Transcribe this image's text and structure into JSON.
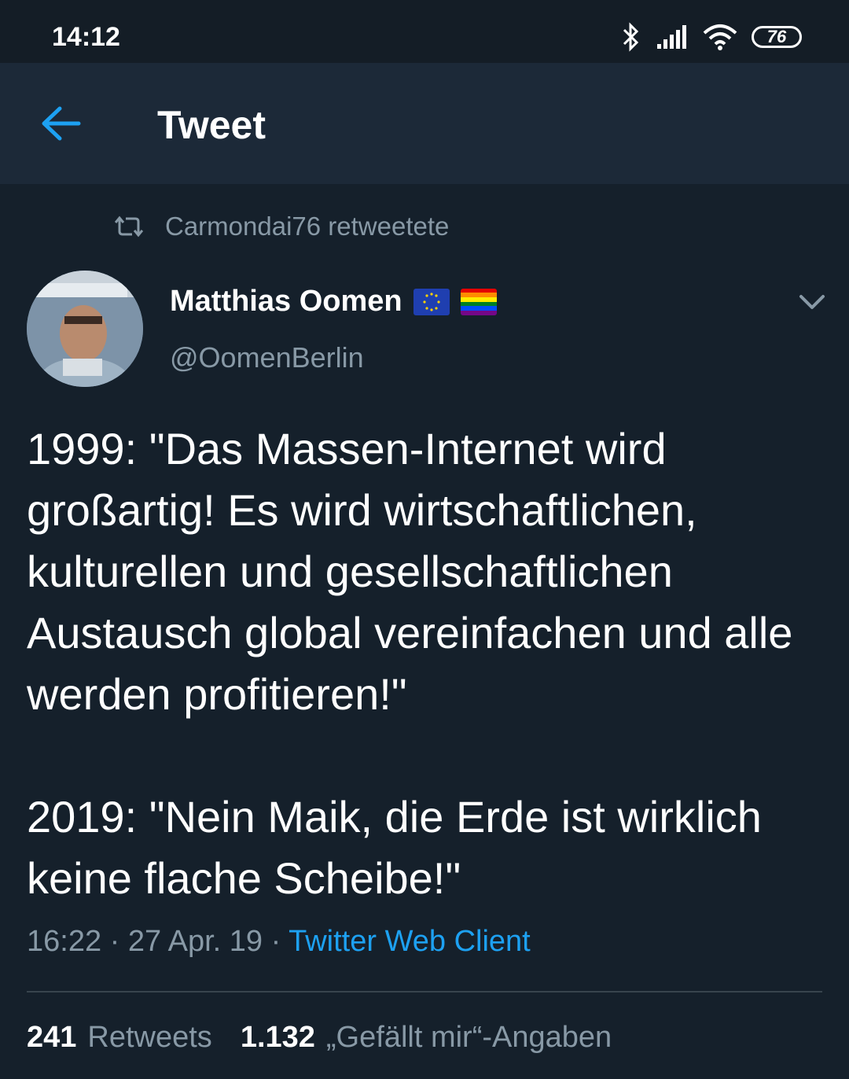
{
  "status_bar": {
    "time": "14:12",
    "battery": "76",
    "icons": [
      "bluetooth-icon",
      "signal-icon",
      "wifi-icon",
      "battery-icon"
    ]
  },
  "header": {
    "title": "Tweet",
    "back_icon": "back-arrow-icon"
  },
  "retweet": {
    "text": "Carmondai76 retweetete",
    "icon": "retweet-icon"
  },
  "author": {
    "name": "Matthias Oomen",
    "handle": "@OomenBerlin",
    "badges": [
      "eu-flag-icon",
      "rainbow-flag-icon"
    ]
  },
  "tweet": {
    "text": "1999: \"Das Massen-Internet wird großartig! Es wird wirtschaftlichen, kulturellen und gesellschaftlichen Austausch global vereinfachen und alle werden profitieren!\"\n\n2019: \"Nein Maik, die Erde ist wirklich keine flache Scheibe!\""
  },
  "meta": {
    "time": "16:22",
    "separator": "·",
    "date": "27 Apr. 19",
    "client": "Twitter Web Client"
  },
  "stats": {
    "retweets_count": "241",
    "retweets_label": "Retweets",
    "likes_count": "1.132",
    "likes_label": "„Gefällt mir“-Angaben"
  },
  "colors": {
    "background": "#15202b",
    "header_bg": "#1c2938",
    "accent": "#1da1f2",
    "secondary_text": "#8899a6"
  }
}
